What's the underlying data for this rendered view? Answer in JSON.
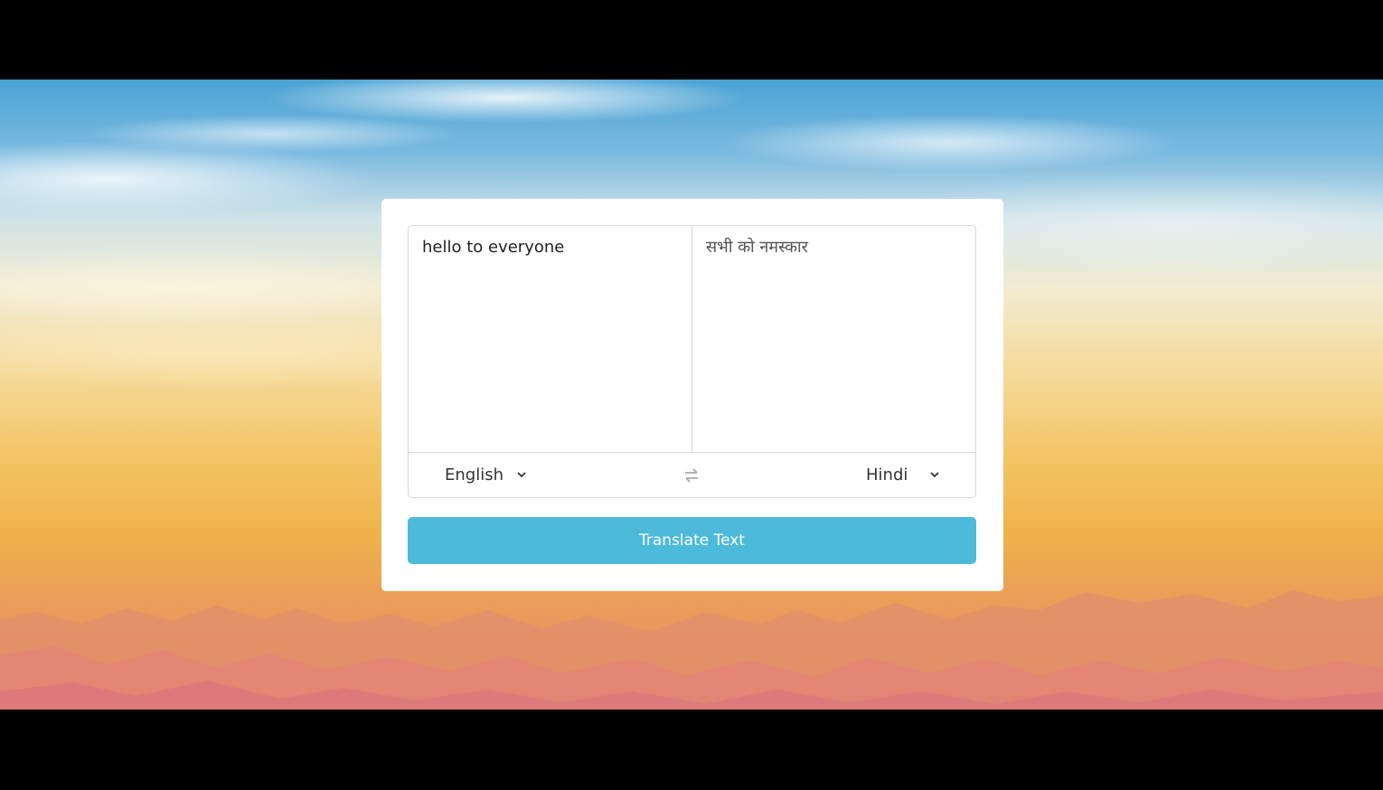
{
  "translator": {
    "from_text": "hello to everyone",
    "to_text": "सभी को नमस्कार",
    "from_language": "English",
    "to_language": "Hindi",
    "translate_button_label": "Translate Text"
  },
  "icons": {
    "exchange": "exchange-icon",
    "chevron": "chevron-down-icon"
  },
  "colors": {
    "button_background": "#4dbad9",
    "button_text": "#ffffff"
  }
}
